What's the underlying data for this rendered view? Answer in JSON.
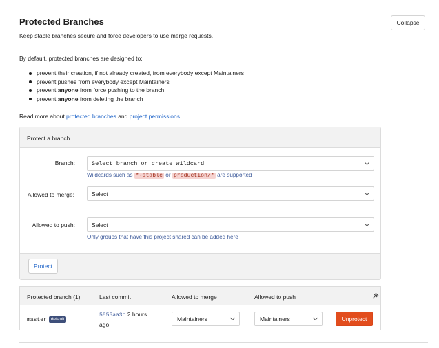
{
  "header": {
    "title": "Protected Branches",
    "subtitle": "Keep stable branches secure and force developers to use merge requests.",
    "collapse_label": "Collapse"
  },
  "intro": "By default, protected branches are designed to:",
  "rules": [
    {
      "pre": "prevent their creation, if not already created, from everybody except Maintainers",
      "strong": "",
      "post": ""
    },
    {
      "pre": "prevent pushes from everybody except Maintainers",
      "strong": "",
      "post": ""
    },
    {
      "pre": "prevent ",
      "strong": "anyone",
      "post": " from force pushing to the branch"
    },
    {
      "pre": "prevent ",
      "strong": "anyone",
      "post": " from deleting the branch"
    }
  ],
  "read_more": {
    "prefix": "Read more about ",
    "link1": "protected branches",
    "middle": " and ",
    "link2": "project permissions",
    "suffix": "."
  },
  "form": {
    "header": "Protect a branch",
    "branch_label": "Branch:",
    "branch_placeholder": "Select branch or create wildcard",
    "wildcard_hint_prefix": "Wildcards such as ",
    "wildcard_example1": "*-stable",
    "wildcard_hint_or": " or ",
    "wildcard_example2": "production/*",
    "wildcard_hint_suffix": " are supported",
    "merge_label": "Allowed to merge:",
    "merge_value": "Select",
    "push_label": "Allowed to push:",
    "push_value": "Select",
    "push_hint": "Only groups that have this project shared can be added here",
    "protect_label": "Protect"
  },
  "table": {
    "columns": [
      "Protected branch (1)",
      "Last commit",
      "Allowed to merge",
      "Allowed to push"
    ],
    "rows": [
      {
        "branch": "master",
        "badge": "default",
        "commit_hash": "5855aa3c",
        "commit_time_1": "2 hours",
        "commit_time_2": "ago",
        "merge": "Maintainers",
        "push": "Maintainers",
        "action": "Unprotect"
      }
    ]
  },
  "colors": {
    "link": "#1f64c8",
    "danger": "#e24d1d",
    "badge": "#3e4f7a"
  }
}
